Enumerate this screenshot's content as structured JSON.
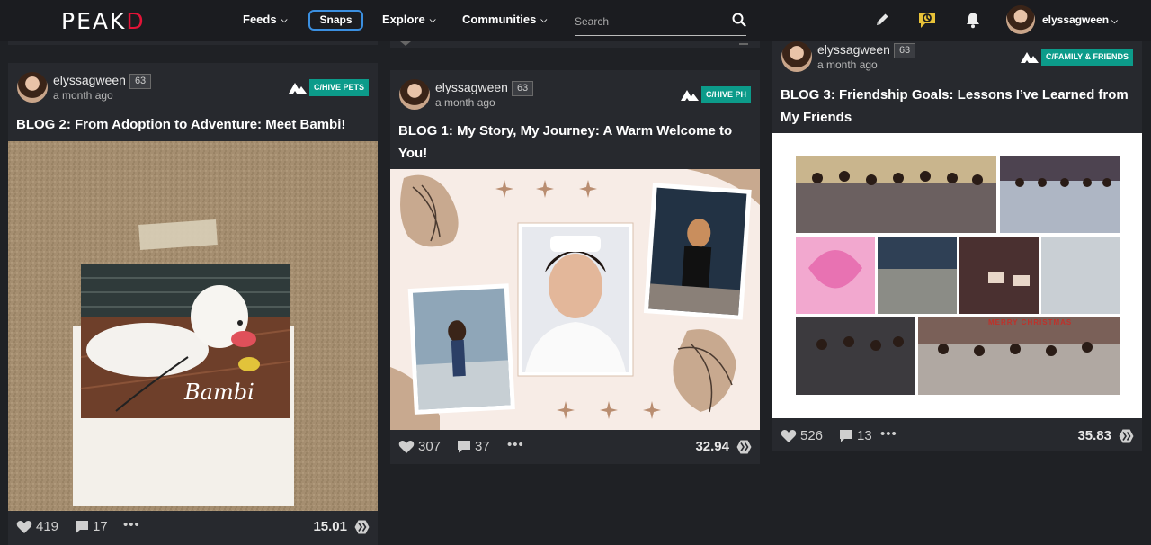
{
  "nav": {
    "logo_main": "PEAK",
    "logo_accent": "D",
    "feeds": "Feeds",
    "snaps": "Snaps",
    "explore": "Explore",
    "communities": "Communities",
    "search_placeholder": "Search",
    "user": "elyssagween"
  },
  "colors": {
    "accent_blue": "#3b8fe0",
    "community_badge": "#0c9b8a",
    "brand_red": "#e31337",
    "background": "#1f2125",
    "card": "#27292e"
  },
  "posts": [
    {
      "author": "elyssagween",
      "reputation": "63",
      "time": "a month ago",
      "community": "C/HIVE PETS",
      "title": "BLOG 2: From Adoption to Adventure: Meet Bambi!",
      "thumb_caption": "Bambi",
      "votes": "419",
      "comments": "17",
      "payout": "15.01"
    },
    {
      "author": "elyssagween",
      "reputation": "63",
      "time": "a month ago",
      "community": "C/HIVE PH",
      "title_line1": "BLOG 1: My Story, My Journey: A Warm Welcome to",
      "title_line2": "You!",
      "votes": "307",
      "comments": "37",
      "payout": "32.94"
    },
    {
      "author": "elyssagween",
      "reputation": "63",
      "time": "a month ago",
      "community": "C/FAMILY & FRIENDS",
      "title_line1": "BLOG 3: Friendship Goals: Lessons I’ve Learned from",
      "title_line2": "My Friends",
      "thumb_banner": "Merry Christmas",
      "votes": "526",
      "comments": "13",
      "payout": "35.83"
    }
  ],
  "icons": [
    "pencil-icon",
    "notification-chat-icon",
    "bell-icon",
    "search-icon",
    "heart-icon",
    "comment-icon",
    "more-icon",
    "hive-icon",
    "chevron-down-icon"
  ]
}
